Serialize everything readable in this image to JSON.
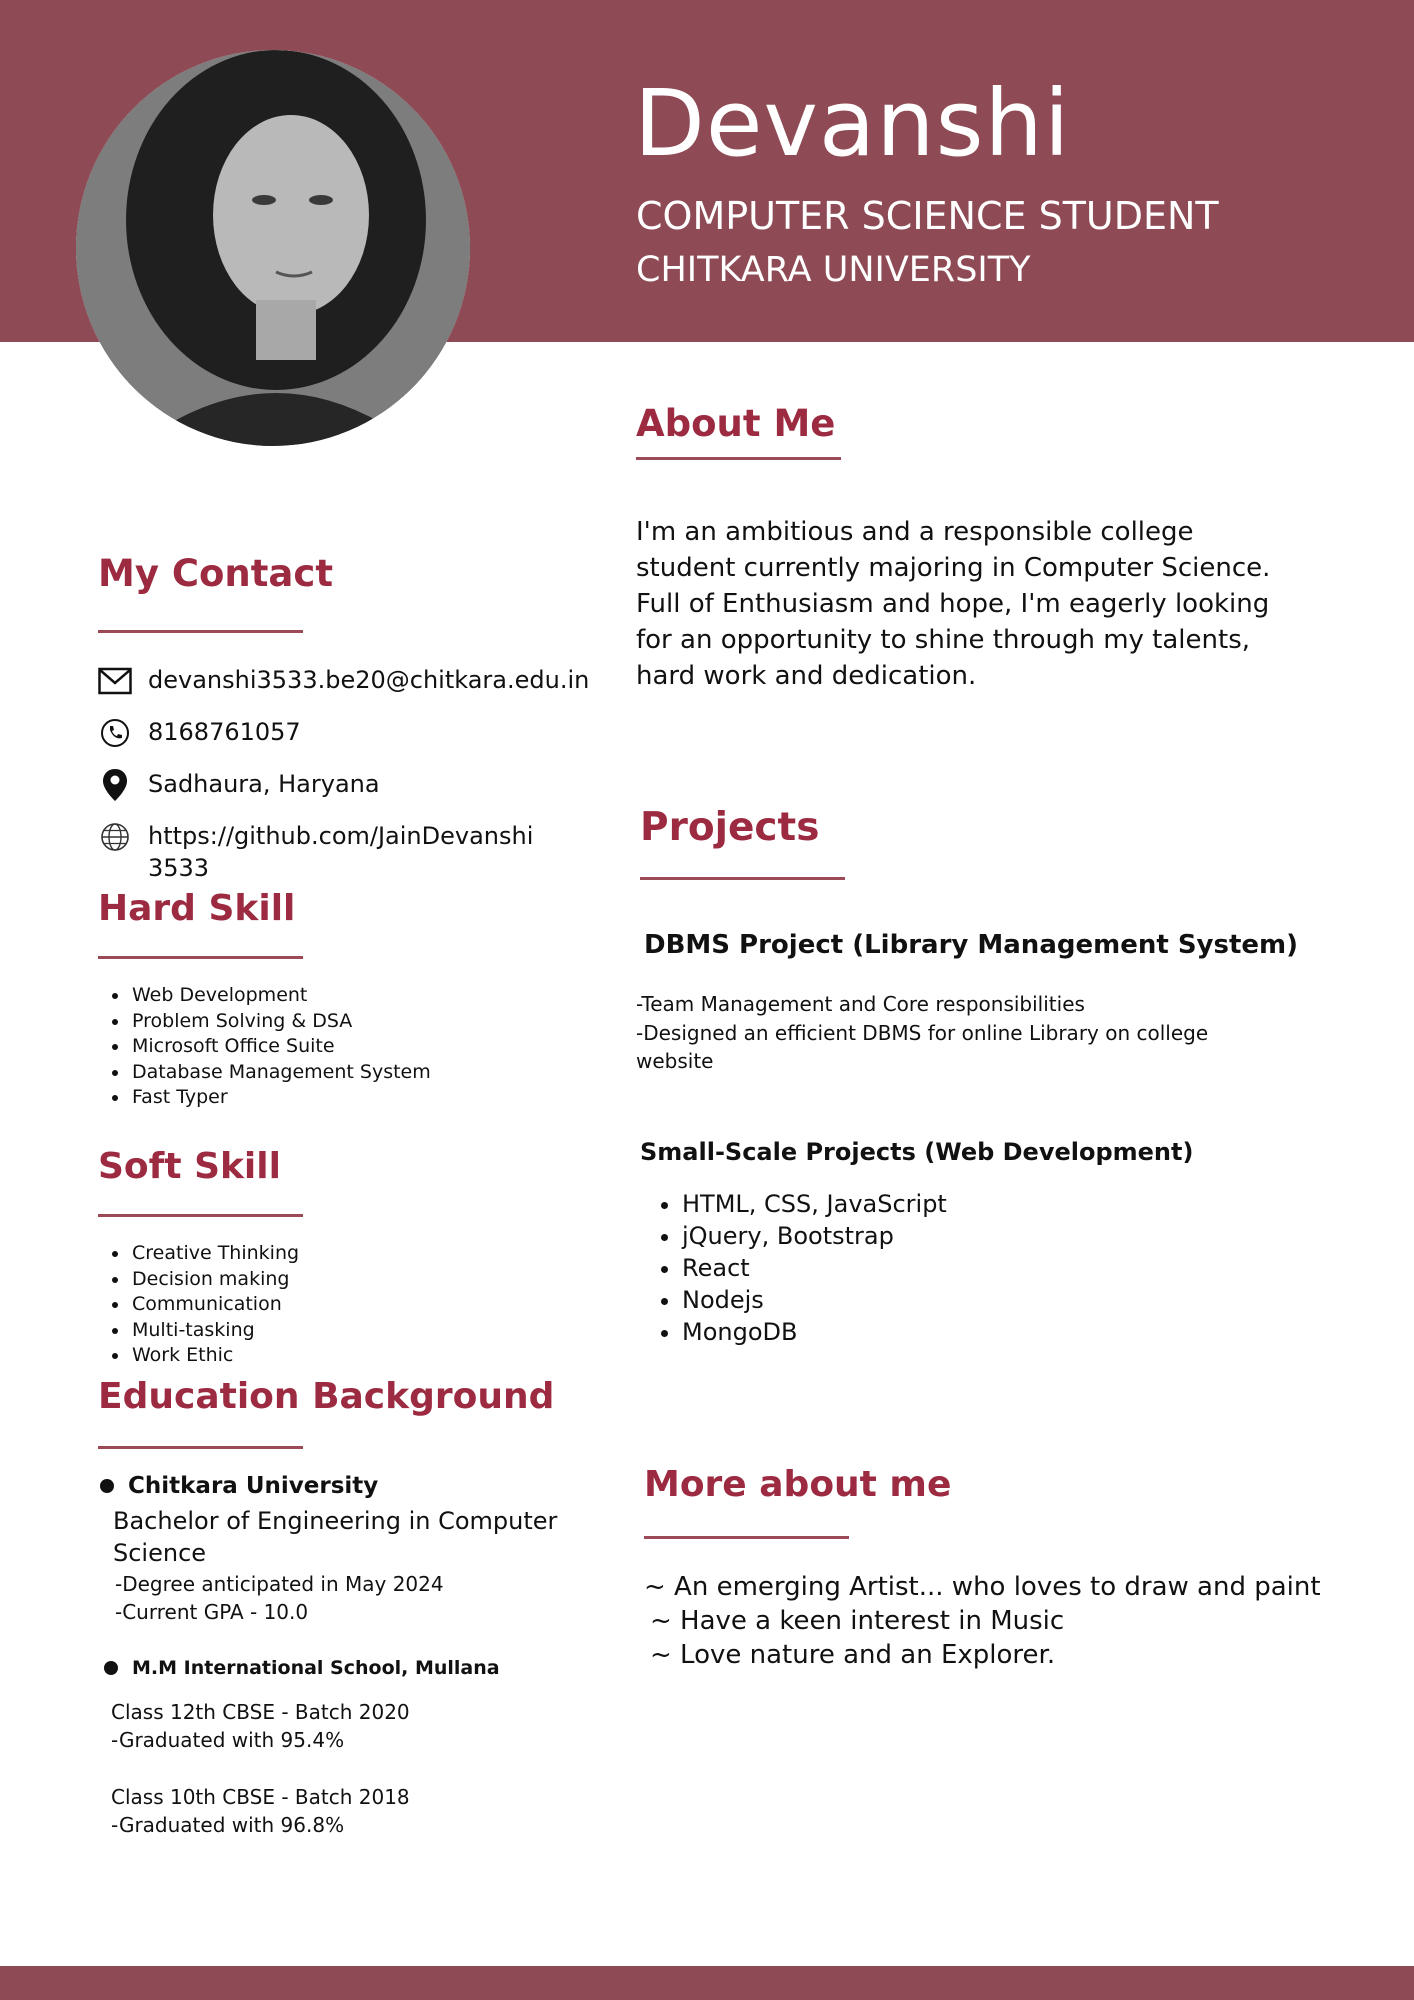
{
  "header": {
    "name": "Devanshi",
    "subtitle": "COMPUTER SCIENCE STUDENT",
    "university": "CHITKARA UNIVERSITY"
  },
  "colors": {
    "band": "#8e4a55",
    "accent": "#9c2a40"
  },
  "about": {
    "title": "About Me",
    "text": "I'm an ambitious and a responsible college student currently majoring in Computer Science. Full of Enthusiasm and hope, I'm eagerly looking for an opportunity to shine through my talents, hard work and dedication."
  },
  "contact": {
    "title": "My Contact",
    "items": [
      {
        "icon": "mail-icon",
        "text": "devanshi3533.be20@chitkara.edu.in"
      },
      {
        "icon": "phone-icon",
        "text": "8168761057"
      },
      {
        "icon": "location-pin-icon",
        "text": "Sadhaura, Haryana"
      },
      {
        "icon": "globe-icon",
        "text": "https://github.com/JainDevanshi3533"
      }
    ]
  },
  "hard_skill": {
    "title": "Hard Skill",
    "items": [
      "Web Development",
      "Problem Solving & DSA",
      "Microsoft Office Suite",
      "Database Management System",
      "Fast Typer"
    ]
  },
  "soft_skill": {
    "title": "Soft Skill",
    "items": [
      "Creative Thinking",
      "Decision making",
      "Communication",
      "Multi-tasking",
      "Work Ethic"
    ]
  },
  "education": {
    "title": "Education Background",
    "school1": "Chitkara University",
    "degree": "Bachelor of Engineering in Computer Science",
    "degree_line1": "-Degree anticipated in May 2024",
    "degree_line2": "-Current GPA - 10.0",
    "school2": "M.M International School, Mullana",
    "class12": "Class 12th CBSE -  Batch 2020",
    "class12_grade": "-Graduated with 95.4%",
    "class10": "Class 10th CBSE - Batch 2018",
    "class10_grade": "-Graduated with 96.8%"
  },
  "projects": {
    "title": "Projects",
    "p1_title": "DBMS Project (Library Management System)",
    "p1_line1": "-Team Management and Core responsibilities",
    "p1_line2": "-Designed an efficient DBMS for online Library on  college website",
    "p2_title": "Small-Scale Projects (Web Development)",
    "p2_items": [
      "HTML, CSS, JavaScript",
      "jQuery, Bootstrap",
      "React",
      "Nodejs",
      "MongoDB"
    ]
  },
  "more": {
    "title": "More about me",
    "lines": [
      "~  An emerging Artist... who loves to draw and paint",
      "~ Have a keen interest in Music",
      "~ Love nature and an Explorer."
    ]
  }
}
